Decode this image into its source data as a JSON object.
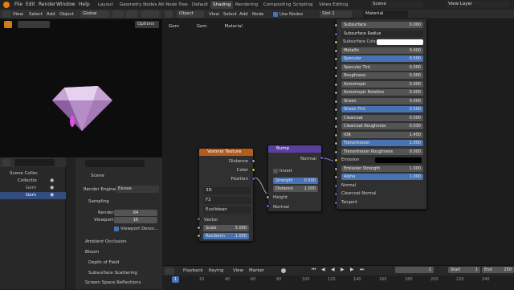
{
  "topbar": {
    "menus": [
      "File",
      "Edit",
      "Render",
      "Window",
      "Help"
    ],
    "tabs": [
      "Layout",
      "Geometry Nodes",
      "Alt Node Tree",
      "Default",
      "Shading",
      "Rendering",
      "Compositing",
      "Scripting",
      "Video Editing"
    ],
    "active_tab": "Shading",
    "scene": "Scene",
    "view_layer": "View Layer"
  },
  "viewport_header": {
    "mode": "Object Mode",
    "menus": [
      "View",
      "Select",
      "Add",
      "Object"
    ],
    "orientation": "Global",
    "options": "Options"
  },
  "node_header": {
    "object": "Object",
    "menus": [
      "View",
      "Select",
      "Add",
      "Node"
    ],
    "use_nodes": "Use Nodes",
    "slot": "Slot 1",
    "material": "Material"
  },
  "breadcrumb": [
    "Gem",
    "Gem",
    "Material"
  ],
  "outliner": {
    "items": [
      "Scene Collec",
      "Collectio",
      "Gem",
      "Gem"
    ]
  },
  "properties": {
    "search_placeholder": "",
    "title": "Scene",
    "render_engine_label": "Render Engine",
    "render_engine": "Eevee",
    "sampling": "Sampling",
    "render_label": "Render",
    "render_value": "64",
    "viewport_label": "Viewport",
    "viewport_value": "16",
    "denoise": "Viewport Denoi...",
    "panels": [
      "Ambient Occlusion",
      "Bloom",
      "Depth of Field",
      "Subsurface Scattering",
      "Screen Space Reflections"
    ]
  },
  "voronoi": {
    "title": "Voronoi Texture",
    "outputs": [
      "Distance",
      "Color",
      "Position"
    ],
    "dim": "3D",
    "metric": "F2",
    "dist": "Euclidean",
    "vector": "Vector",
    "scale_label": "Scale",
    "scale": "3.000",
    "random_label": "Randomn",
    "random": "1.000"
  },
  "bump": {
    "title": "Bump",
    "output": "Normal",
    "invert": "Invert",
    "strength_label": "Strength",
    "strength": "0.500",
    "distance_label": "Distance",
    "distance": "1.000",
    "inputs": [
      "Height",
      "Normal"
    ]
  },
  "bsdf": {
    "rows": [
      {
        "label": "Subsurface",
        "value": "0.000",
        "style": "field"
      },
      {
        "label": "Subsurface Radius",
        "value": "",
        "style": "dropdown"
      },
      {
        "label": "Subsurface Colo",
        "value": "",
        "style": "color"
      },
      {
        "label": "Metallic",
        "value": "0.000",
        "style": "field"
      },
      {
        "label": "Specular",
        "value": "0.500",
        "style": "blue"
      },
      {
        "label": "Specular Tint",
        "value": "0.000",
        "style": "field"
      },
      {
        "label": "Roughness",
        "value": "0.000",
        "style": "field"
      },
      {
        "label": "Anisotropic",
        "value": "0.000",
        "style": "field"
      },
      {
        "label": "Anisotropic Rotation",
        "value": "0.000",
        "style": "field"
      },
      {
        "label": "Sheen",
        "value": "0.000",
        "style": "field"
      },
      {
        "label": "Sheen Tint",
        "value": "0.500",
        "style": "blue"
      },
      {
        "label": "Clearcoat",
        "value": "0.000",
        "style": "field"
      },
      {
        "label": "Clearcoat Roughness",
        "value": "0.030",
        "style": "field"
      },
      {
        "label": "IOR",
        "value": "1.450",
        "style": "field"
      },
      {
        "label": "Transmission",
        "value": "1.000",
        "style": "blue"
      },
      {
        "label": "Transmission Roughness",
        "value": "0.000",
        "style": "field"
      },
      {
        "label": "Emission",
        "value": "",
        "style": "emission"
      },
      {
        "label": "Emission Strength",
        "value": "1.000",
        "style": "field"
      },
      {
        "label": "Alpha",
        "value": "1.000",
        "style": "blue"
      },
      {
        "label": "Normal",
        "value": "",
        "style": "plain"
      },
      {
        "label": "Clearcoat Normal",
        "value": "",
        "style": "plain"
      },
      {
        "label": "Tangent",
        "value": "",
        "style": "plain"
      }
    ]
  },
  "timeline": {
    "menus": [
      "Playback",
      "Keying",
      "View",
      "Marker"
    ],
    "current": "1",
    "start_label": "Start",
    "start": "1",
    "end_label": "End",
    "end": "250",
    "ticks": [
      "20",
      "40",
      "60",
      "80",
      "100",
      "120",
      "140",
      "160",
      "180",
      "200",
      "220",
      "240"
    ],
    "frame": "1"
  },
  "colors": {
    "accent": "#4772b3",
    "voronoi_header": "#b35c1e",
    "bump_header": "#5b3fa0"
  }
}
